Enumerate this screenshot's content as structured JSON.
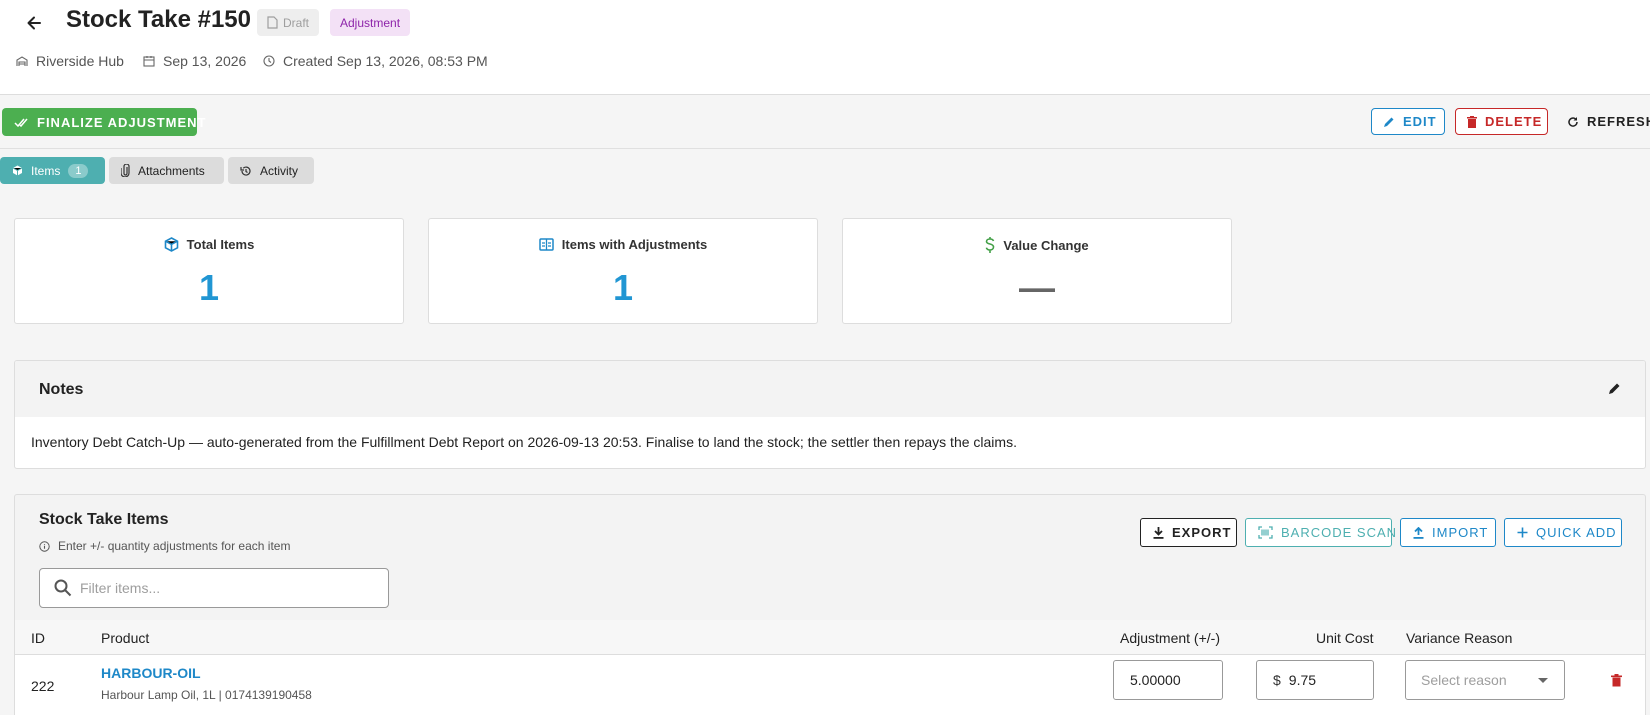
{
  "header": {
    "title": "Stock Take #150",
    "status": "Draft",
    "type": "Adjustment",
    "location": "Riverside Hub",
    "date": "Sep 13, 2026",
    "created": "Created Sep 13, 2026, 08:53 PM"
  },
  "actions": {
    "finalize": "FINALIZE ADJUSTMENT",
    "edit": "EDIT",
    "delete": "DELETE",
    "refresh": "REFRESH"
  },
  "tabs": [
    {
      "label": "Items",
      "count": "1",
      "active": true
    },
    {
      "label": "Attachments"
    },
    {
      "label": "Activity"
    }
  ],
  "stats": [
    {
      "label": "Total Items",
      "value": "1",
      "icon": "cube-icon"
    },
    {
      "label": "Items with Adjustments",
      "value": "1",
      "icon": "compare-icon"
    },
    {
      "label": "Value Change",
      "value": "—",
      "icon": "dollar-icon"
    }
  ],
  "notes": {
    "title": "Notes",
    "body": "Inventory Debt Catch-Up — auto-generated from the Fulfillment Debt Report on 2026-09-13 20:53. Finalise to land the stock; the settler then repays the claims."
  },
  "items_section": {
    "title": "Stock Take Items",
    "help": "Enter +/- quantity adjustments for each item",
    "filter_placeholder": "Filter items...",
    "buttons": {
      "export": "EXPORT",
      "barcode": "BARCODE SCAN",
      "import": "IMPORT",
      "quick_add": "QUICK ADD"
    },
    "columns": {
      "id": "ID",
      "product": "Product",
      "adjustment": "Adjustment (+/-)",
      "unit_cost": "Unit Cost",
      "reason": "Variance Reason"
    },
    "rows": [
      {
        "id": "222",
        "code": "HARBOUR-OIL",
        "description": "Harbour Lamp Oil, 1L  | 0174139190458",
        "adjustment": "5.00000",
        "currency": "$",
        "unit_cost": "9.75",
        "reason_placeholder": "Select reason"
      }
    ]
  },
  "colors": {
    "accent": "#1e88c8",
    "success": "#4caf50",
    "danger": "#c62828",
    "teal": "#4eafb0"
  }
}
